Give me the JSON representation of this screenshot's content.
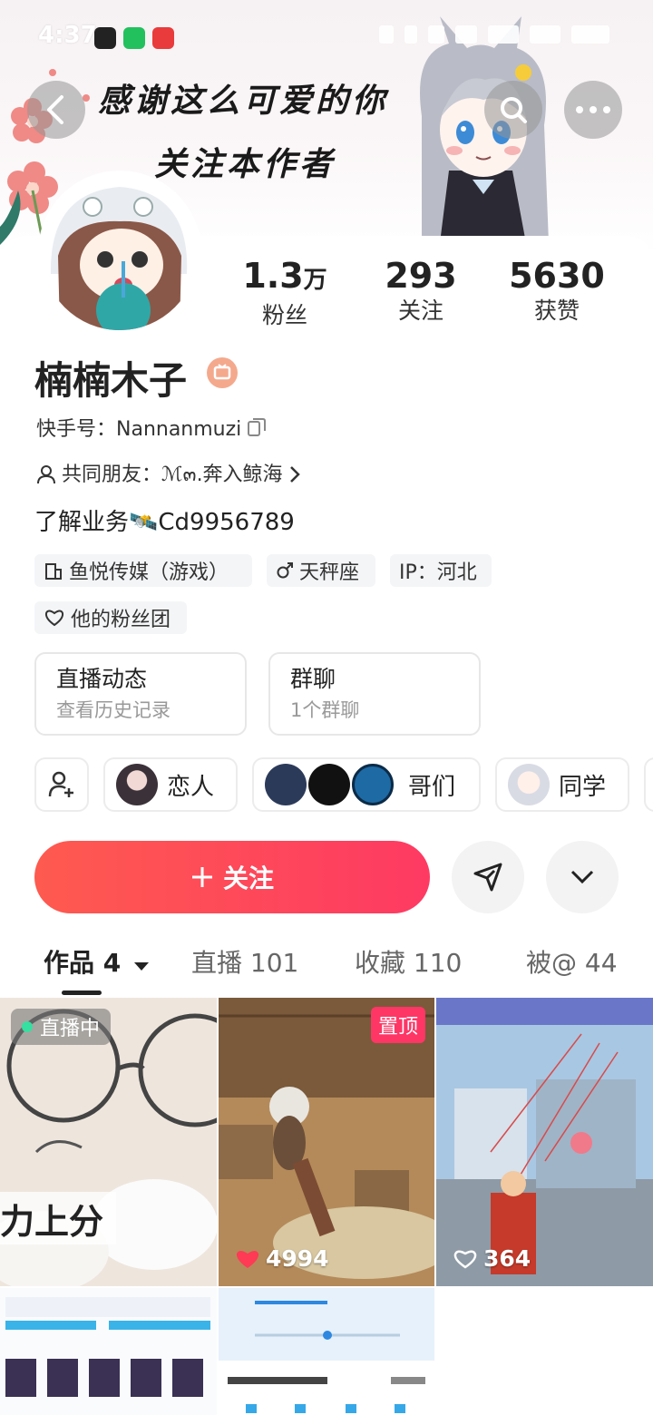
{
  "status": {
    "time": "4:37"
  },
  "banner": {
    "line1": "感谢这么可爱的你",
    "line2": "关注本作者"
  },
  "profile": {
    "name": "楠楠木子",
    "stats": [
      {
        "num": "1.3",
        "unit": "万",
        "label": "粉丝"
      },
      {
        "num": "293",
        "unit": "",
        "label": "关注"
      },
      {
        "num": "5630",
        "unit": "",
        "label": "获赞"
      }
    ],
    "kuaishou_id": "快手号：Nannanmuzi",
    "mutual_friends": "共同朋友：ℳ๓.奔入鲸海",
    "bio": "了解业务🛰️Cd9956789"
  },
  "tags": [
    "鱼悦传媒（游戏）",
    "天秤座",
    "IP：河北",
    "他的粉丝团"
  ],
  "boxes": [
    {
      "title": "直播动态",
      "sub": "查看历史记录"
    },
    {
      "title": "群聊",
      "sub": "1个群聊"
    }
  ],
  "chips": [
    "恋人",
    "哥们",
    "同学"
  ],
  "follow_label": "关注",
  "tabs": [
    "作品 4",
    "直播 101",
    "收藏 110",
    "被@ 44"
  ],
  "grid": {
    "live_label": "直播中",
    "caption": "力上分",
    "pinned_label": "置顶",
    "likes": [
      "4994",
      "364"
    ]
  }
}
